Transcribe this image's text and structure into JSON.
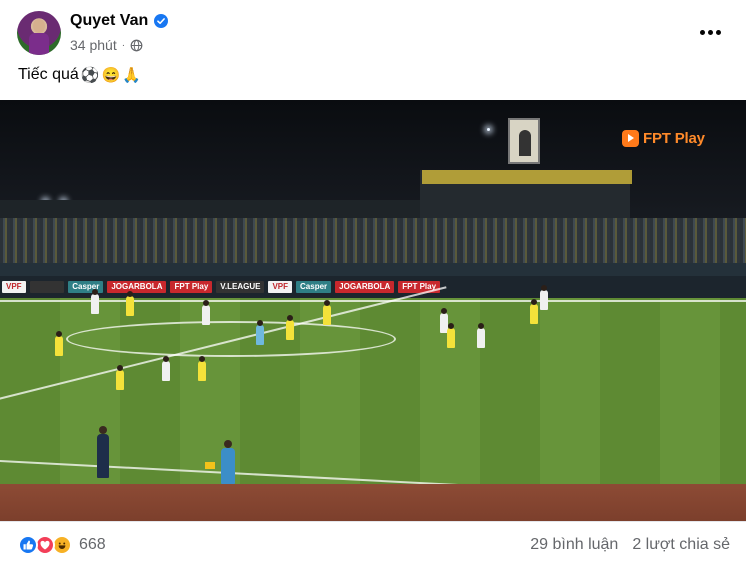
{
  "post": {
    "author_name": "Quyet Van",
    "timestamp": "34 phút",
    "audience_icon": "globe-icon",
    "more_icon": "more-horizontal-icon",
    "text": "Tiếc quá",
    "emojis": [
      "⚽",
      "😄",
      "🙏"
    ]
  },
  "media": {
    "watermark": "FPT Play",
    "ads": [
      "VPF",
      "Casper",
      "JOGARBOLA",
      "FPT Play",
      "V.LEAGUE",
      "VPF",
      "Casper",
      "JOGARBOLA",
      "FPT Play"
    ]
  },
  "footer": {
    "reactions": [
      "like",
      "love",
      "haha"
    ],
    "reaction_count": "668",
    "comments": "29 bình luận",
    "shares": "2 lượt chia sẻ"
  },
  "colors": {
    "accent": "#1877f2",
    "secondary_text": "#65676b"
  }
}
